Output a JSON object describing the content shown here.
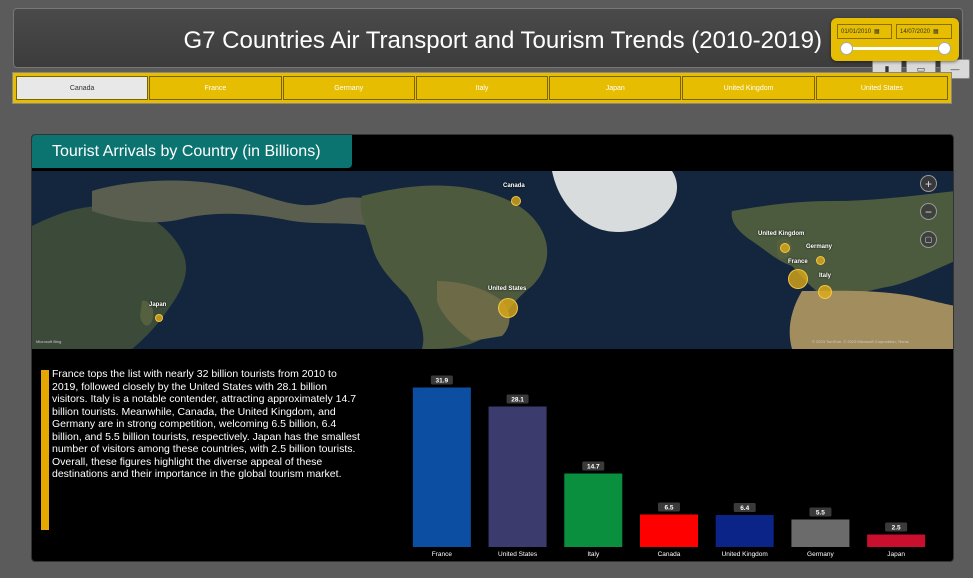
{
  "header": {
    "title": "G7 Countries Air Transport and Tourism Trends (2010-2019)",
    "date_start": "01/01/2010",
    "date_end": "14/07/2020",
    "slider_start_fraction": 0,
    "slider_end_fraction": 1
  },
  "tabs": [
    {
      "label": "Canada",
      "active": true
    },
    {
      "label": "France",
      "active": false
    },
    {
      "label": "Germany",
      "active": false
    },
    {
      "label": "Italy",
      "active": false
    },
    {
      "label": "Japan",
      "active": false
    },
    {
      "label": "United Kingdom",
      "active": false
    },
    {
      "label": "United States",
      "active": false
    }
  ],
  "panel": {
    "title": "Tourist Arrivals by Country (in Billions)"
  },
  "map": {
    "labels": {
      "canada": "Canada",
      "united_kingdom": "United Kingdom",
      "germany": "Germany",
      "france": "France",
      "italy": "Italy",
      "united_states": "United States",
      "japan": "Japan"
    },
    "logo": "Microsoft Bing",
    "credit": "© 2023 TomTom, © 2023 Microsoft Corporation, Terms",
    "controls": {
      "zoom_in": "plus-icon",
      "zoom_out": "minus-icon",
      "style": "map-style-icon"
    }
  },
  "description": {
    "para1": "France tops the list with nearly 32 billion tourists from 2010 to 2019, followed closely by the United States with 28.1 billion visitors. Italy is a notable contender, attracting approximately 14.7 billion tourists. Meanwhile, Canada, the United Kingdom, and Germany are in strong competition, welcoming 6.5 billion, 6.4 billion, and 5.5 billion tourists, respectively. Japan has the smallest number of visitors among these countries, with 2.5 billion tourists.",
    "para2": "Overall, these figures highlight the diverse appeal of these destinations and their importance in the global tourism market."
  },
  "colors": {
    "accent": "#e6bd00",
    "panel_title": "#0c7470"
  },
  "chart_data": {
    "type": "bar",
    "categories": [
      "France",
      "United States",
      "Italy",
      "Canada",
      "United Kingdom",
      "Germany",
      "Japan"
    ],
    "values": [
      31.9,
      28.1,
      14.7,
      6.5,
      6.4,
      5.5,
      2.5
    ],
    "value_labels": [
      "31.9",
      "28.1",
      "14.7",
      "6.5",
      "6.4",
      "5.5",
      "2.5"
    ],
    "colors": [
      "#0b4ea2",
      "#3b3b6e",
      "#0a8f3f",
      "#ff0000",
      "#0a2487",
      "#6b6b6b",
      "#c8102e"
    ],
    "ylim": [
      0,
      32
    ],
    "grid": false
  }
}
